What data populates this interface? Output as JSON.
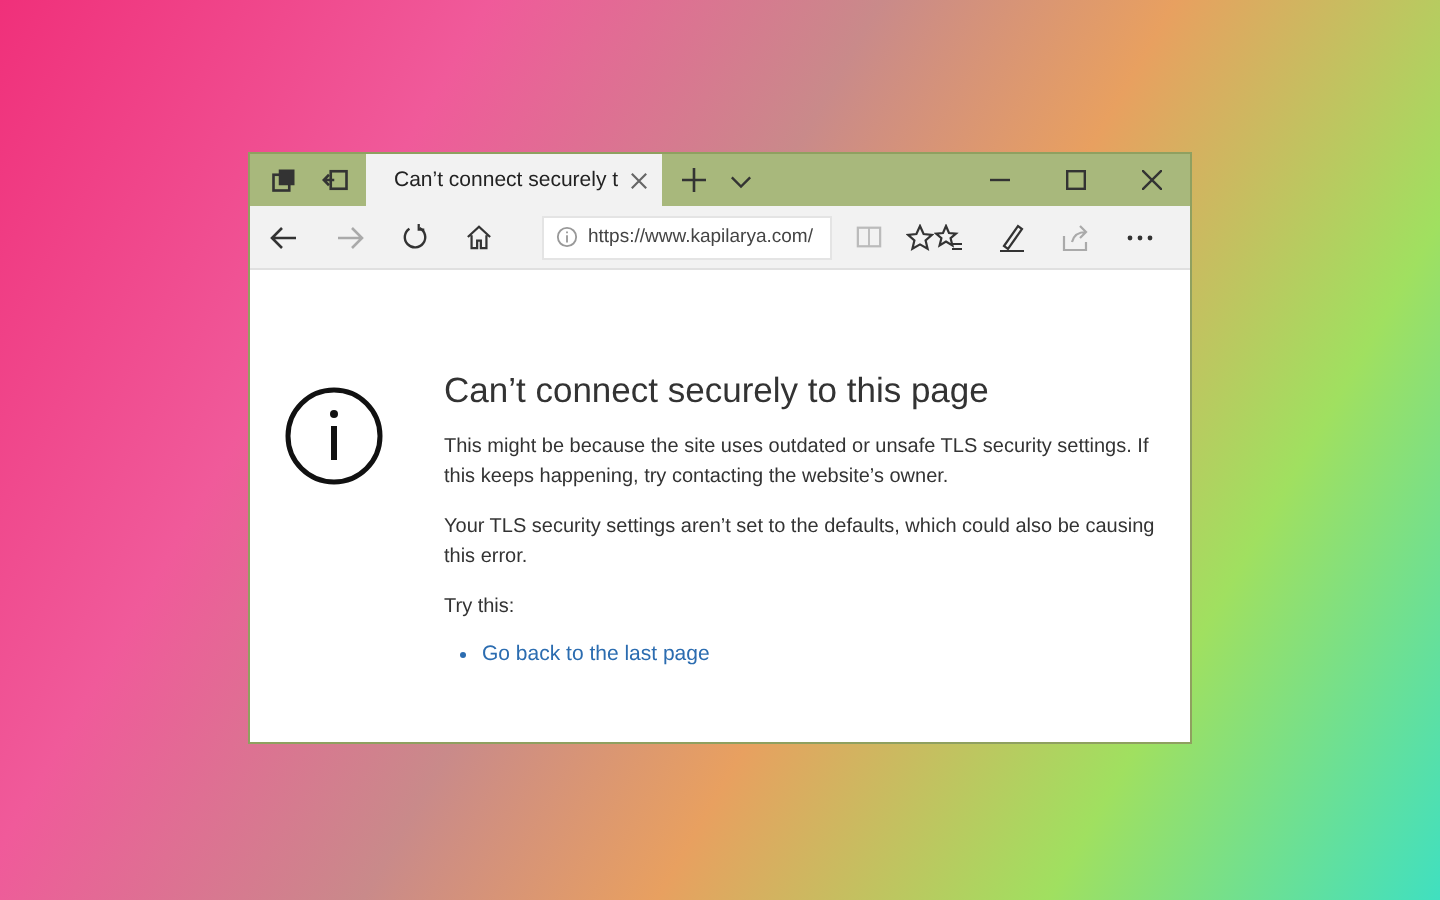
{
  "window": {
    "tabs": [
      {
        "title": "Can’t connect securely t",
        "selected": true
      }
    ],
    "address": {
      "url": "https://www.kapilarya.com/"
    }
  },
  "page": {
    "heading": "Can’t connect securely to this page",
    "paragraphs": [
      "This might be because the site uses outdated or unsafe TLS security settings. If this keeps happening, try contacting the website’s owner.",
      "Your TLS security settings aren’t set to the defaults, which could also be causing this error."
    ],
    "try_label": "Try this:",
    "suggestions": [
      "Go back to the last page"
    ]
  }
}
